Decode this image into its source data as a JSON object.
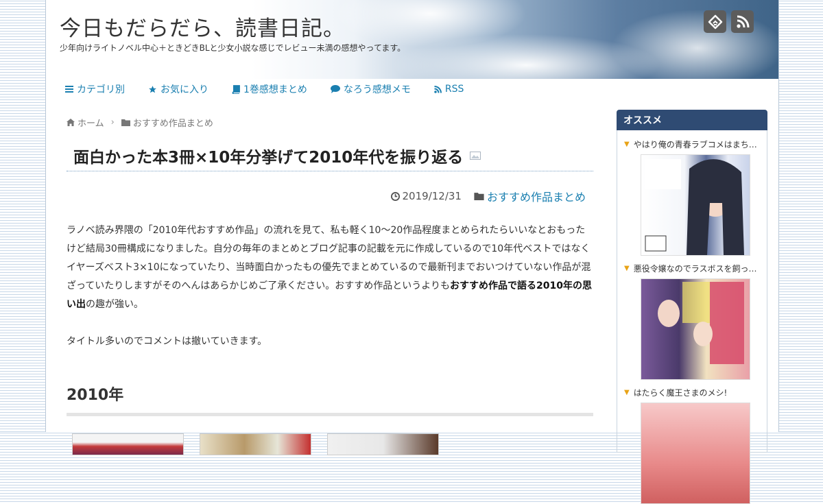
{
  "site": {
    "title": "今日もだらだら、読書日記。",
    "description": "少年向けライトノベル中心＋ときどきBLと少女小説な感じでレビュー未満の感想やってます。"
  },
  "header_icons": [
    "feedly-icon",
    "rss-icon"
  ],
  "nav": [
    {
      "label": "カテゴリ別",
      "icon": "list-icon"
    },
    {
      "label": "お気に入り",
      "icon": "star-icon"
    },
    {
      "label": "1巻感想まとめ",
      "icon": "book-icon"
    },
    {
      "label": "なろう感想メモ",
      "icon": "comment-icon"
    },
    {
      "label": "RSS",
      "icon": "rss-icon"
    }
  ],
  "breadcrumb": {
    "home": "ホーム",
    "category": "おすすめ作品まとめ"
  },
  "post": {
    "title": "面白かった本3冊×10年分挙げて2010年代を振り返る",
    "date": "2019/12/31",
    "category": "おすすめ作品まとめ",
    "p1_a": "ラノベ読み界隈の「2010年代おすすめ作品」の流れを見て、私も軽く10〜20作品程度まとめられたらいいなとおもったけど結局30冊構成になりました。自分の毎年のまとめとブログ記事の記載を元に作成しているので10年代ベストではなくイヤーズベスト3×10になっていたり、当時面白かったもの優先でまとめているので最新刊までおいつけていない作品が混ざっていたりしますがそのへんはあらかじめご了承ください。おすすめ作品というよりも",
    "p1_bold": "おすすめ作品で語る2010年の思い出",
    "p1_b": "の趣が強い。",
    "p2": "タイトル多いのでコメントは撤いていきます。",
    "section": "2010年"
  },
  "sidebar": {
    "widget_title": "オススメ",
    "items": [
      {
        "title": "やはり俺の青春ラブコメはまち…"
      },
      {
        "title": "悪役令嬢なのでラスボスを飼っ…"
      },
      {
        "title": "はたらく魔王さまのメシ!"
      }
    ]
  },
  "colors": {
    "accent": "#1a7fb0",
    "widget_bg": "#2f4b73",
    "marker": "#e8a317"
  }
}
